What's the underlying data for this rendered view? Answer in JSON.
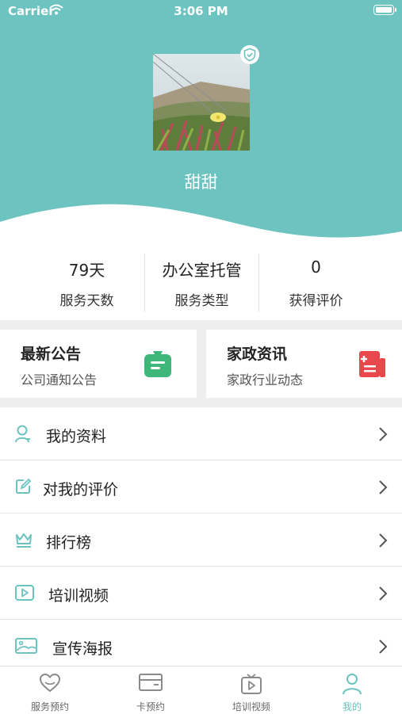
{
  "statusbar": {
    "carrier": "Carrier",
    "time": "3:06 PM"
  },
  "profile": {
    "username": "甜甜"
  },
  "stats": [
    {
      "value": "79天",
      "label": "服务天数"
    },
    {
      "value": "办公室托管",
      "label": "服务类型"
    },
    {
      "value": "0",
      "label": "获得评价"
    }
  ],
  "cards": [
    {
      "title": "最新公告",
      "subtitle": "公司通知公告",
      "icon": "notice-bag-icon"
    },
    {
      "title": "家政资讯",
      "subtitle": "家政行业动态",
      "icon": "news-document-icon"
    }
  ],
  "menu": [
    {
      "label": "我的资料",
      "icon": "user-icon"
    },
    {
      "label": "对我的评价",
      "icon": "edit-icon"
    },
    {
      "label": "排行榜",
      "icon": "crown-icon"
    },
    {
      "label": "培训视频",
      "icon": "video-play-icon"
    },
    {
      "label": "宣传海报",
      "icon": "image-icon"
    }
  ],
  "tabbar": [
    {
      "label": "服务预约",
      "icon": "heart-icon",
      "active": false
    },
    {
      "label": "卡预约",
      "icon": "card-icon",
      "active": false
    },
    {
      "label": "培训视频",
      "icon": "tv-play-icon",
      "active": false
    },
    {
      "label": "我的",
      "icon": "person-icon",
      "active": true
    }
  ],
  "colors": {
    "accent": "#6cc3c0",
    "green": "#3fb77a",
    "red": "#e8474c",
    "divider": "#eeeeee"
  }
}
